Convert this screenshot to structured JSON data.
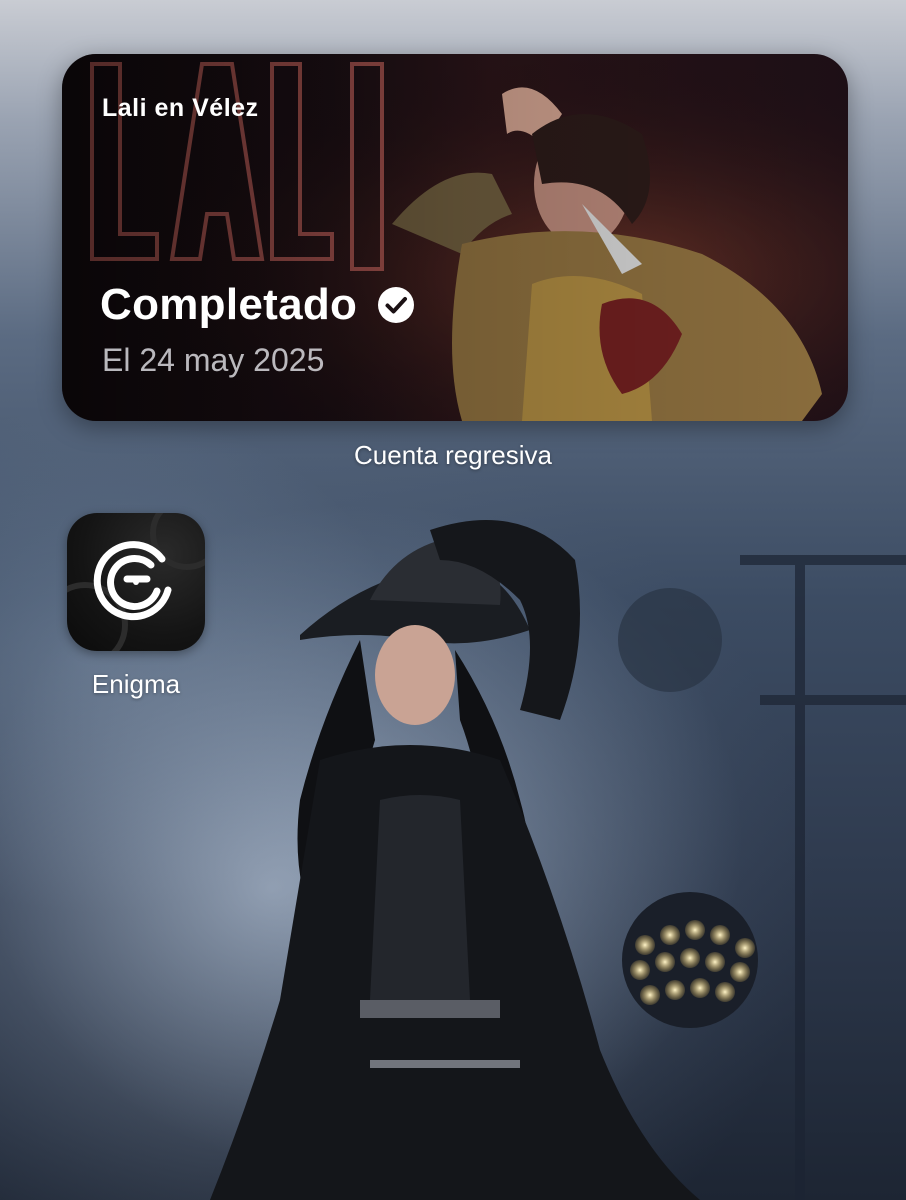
{
  "widget": {
    "title": "Lali en Vélez",
    "status": "Completado",
    "status_icon": "checkmark-circle-icon",
    "date": "El 24 may 2025",
    "caption": "Cuenta regresiva"
  },
  "apps": [
    {
      "label": "Enigma",
      "icon": "enigma-maze-icon"
    }
  ],
  "colors": {
    "label_text": "#ffffff",
    "widget_date_text": "#c8c8cc"
  }
}
